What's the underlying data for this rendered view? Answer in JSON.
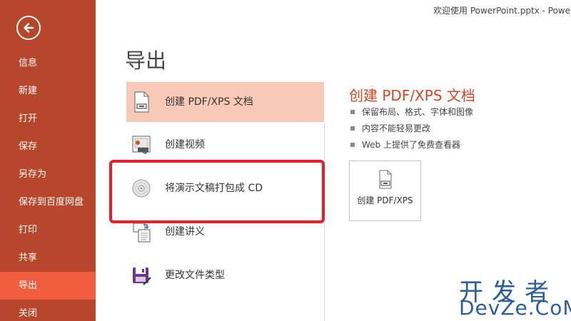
{
  "window": {
    "title": "欢迎使用 PowerPoint.pptx - Power"
  },
  "sidebar": {
    "back_icon": "back-arrow-icon",
    "items": [
      {
        "label": "信息"
      },
      {
        "label": "新建"
      },
      {
        "label": "打开"
      },
      {
        "label": "保存"
      },
      {
        "label": "另存为"
      },
      {
        "label": "保存到百度网盘"
      },
      {
        "label": "打印"
      },
      {
        "label": "共享"
      },
      {
        "label": "导出",
        "active": true
      },
      {
        "label": "关闭"
      }
    ],
    "colors": {
      "background": "#b7472a",
      "active": "#f15e3f"
    }
  },
  "main": {
    "title": "导出",
    "options": [
      {
        "label": "创建 PDF/XPS 文档",
        "icon": "pdf-document-icon",
        "selected": true
      },
      {
        "label": "创建视频",
        "icon": "video-icon"
      },
      {
        "label": "将演示文稿打包成 CD",
        "icon": "cd-disc-icon"
      },
      {
        "label": "创建讲义",
        "icon": "handout-icon"
      },
      {
        "label": "更改文件类型",
        "icon": "file-type-icon"
      }
    ]
  },
  "detail": {
    "title": "创建 PDF/XPS 文档",
    "bullets": [
      "保留布局、格式、字体和图像",
      "内容不能轻易更改",
      "Web 上提供了免费查看器"
    ],
    "button_label": "创建 PDF/XPS",
    "accent": "#d24726"
  },
  "watermark": {
    "cn": "开发者",
    "en": "DevZe.CoM"
  }
}
